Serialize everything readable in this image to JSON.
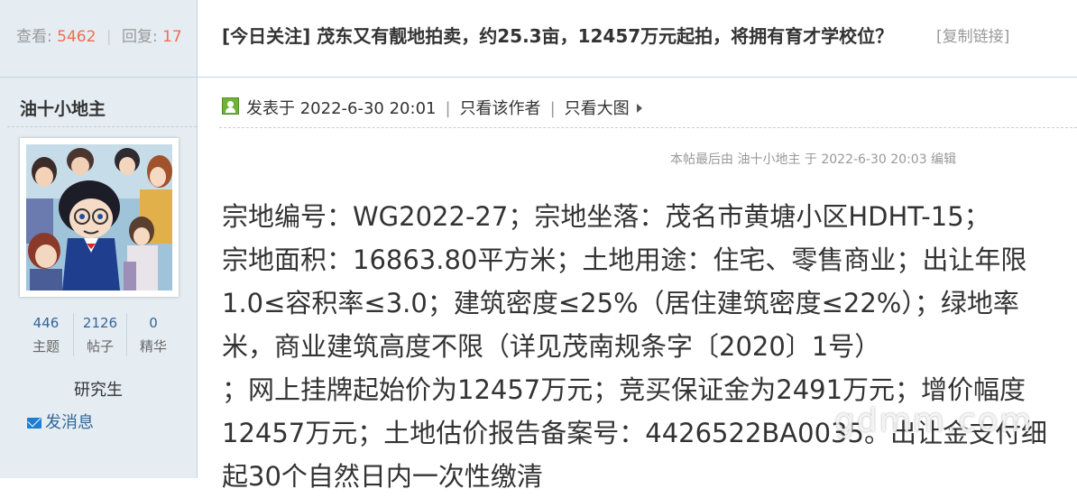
{
  "stats": {
    "views_label": "查看:",
    "views": "5462",
    "replies_label": "回复:",
    "replies": "17",
    "separator": "|"
  },
  "thread": {
    "title": "[今日关注] 茂东又有靓地拍卖，约25.3亩，12457万元起拍，将拥有育才学校位？",
    "copy_link": "[复制链接]"
  },
  "author": {
    "name": "油十小地主",
    "threads_count": "446",
    "threads_label": "主题",
    "posts_count": "2126",
    "posts_label": "帖子",
    "digest_count": "0",
    "digest_label": "精华",
    "rank": "研究生",
    "send_message": "发消息"
  },
  "post": {
    "posted_at": "发表于 2022-6-30 20:01",
    "only_author": "只看该作者",
    "large_image": "只看大图",
    "edit_note": "本帖最后由 油十小地主 于 2022-6-30 20:03 编辑",
    "lines": [
      "宗地编号：WG2022-27；宗地坐落：茂名市黄塘小区HDHT-15；",
      "宗地面积：16863.80平方米；土地用途：住宅、零售商业；出让年限",
      "1.0≤容积率≤3.0；建筑密度≤25%（居住建筑密度≤22%）；绿地率",
      "米，商业建筑高度不限（详见茂南规条字〔2020〕1号）",
      "；网上挂牌起始价为12457万元；竞买保证金为2491万元；增价幅度",
      "12457万元；土地估价报告备案号：4426522BA0035。出让金支付细",
      "起30个自然日内一次性缴清"
    ],
    "watermark": "gdmm.com"
  },
  "colors": {
    "sidebar_bg": "#e5edf2",
    "accent_number": "#f26c4f",
    "link_blue": "#336699",
    "border": "#c2d5e3"
  }
}
